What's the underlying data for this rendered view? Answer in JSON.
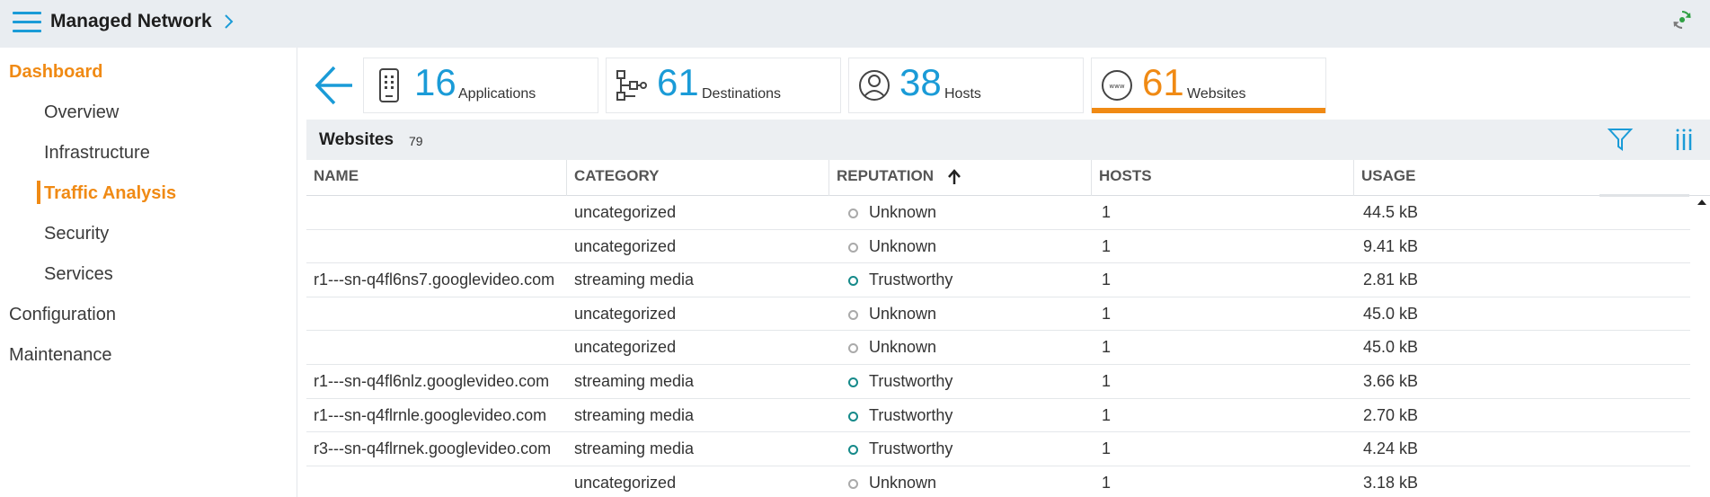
{
  "header": {
    "title": "Managed Network",
    "menu_icon": "hamburger-menu-icon",
    "chevron_icon": "chevron-right-icon",
    "refresh_icon": "refresh-icon"
  },
  "sidebar": {
    "items": [
      {
        "label": "Dashboard"
      },
      {
        "label": "Overview"
      },
      {
        "label": "Infrastructure"
      },
      {
        "label": "Traffic Analysis"
      },
      {
        "label": "Security"
      },
      {
        "label": "Services"
      },
      {
        "label": "Configuration"
      },
      {
        "label": "Maintenance"
      }
    ],
    "active_item": "Traffic Analysis"
  },
  "stats": [
    {
      "value": "16",
      "label": "Applications",
      "icon": "mobile-device-icon"
    },
    {
      "value": "61",
      "label": "Destinations",
      "icon": "network-tree-icon"
    },
    {
      "value": "38",
      "label": "Hosts",
      "icon": "user-circle-icon"
    },
    {
      "value": "61",
      "label": "Websites",
      "icon": "www-globe-icon",
      "selected": true
    }
  ],
  "panel": {
    "title": "Websites",
    "count": "79"
  },
  "table": {
    "columns": [
      "NAME",
      "CATEGORY",
      "REPUTATION",
      "HOSTS",
      "USAGE"
    ],
    "sorted_by": "REPUTATION",
    "sort_direction": "ascending",
    "rows": [
      {
        "name": "",
        "category": "uncategorized",
        "reputation": "Unknown",
        "hosts": "1",
        "usage": "44.5 kB"
      },
      {
        "name": "",
        "category": "uncategorized",
        "reputation": "Unknown",
        "hosts": "1",
        "usage": "9.41 kB"
      },
      {
        "name": "r1---sn-q4fl6ns7.googlevideo.com",
        "category": "streaming media",
        "reputation": "Trustworthy",
        "hosts": "1",
        "usage": "2.81 kB"
      },
      {
        "name": "",
        "category": "uncategorized",
        "reputation": "Unknown",
        "hosts": "1",
        "usage": "45.0 kB"
      },
      {
        "name": "",
        "category": "uncategorized",
        "reputation": "Unknown",
        "hosts": "1",
        "usage": "45.0 kB"
      },
      {
        "name": "r1---sn-q4fl6nlz.googlevideo.com",
        "category": "streaming media",
        "reputation": "Trustworthy",
        "hosts": "1",
        "usage": "3.66 kB"
      },
      {
        "name": "r1---sn-q4flrnle.googlevideo.com",
        "category": "streaming media",
        "reputation": "Trustworthy",
        "hosts": "1",
        "usage": "2.70 kB"
      },
      {
        "name": "r3---sn-q4flrnek.googlevideo.com",
        "category": "streaming media",
        "reputation": "Trustworthy",
        "hosts": "1",
        "usage": "4.24 kB"
      },
      {
        "name": "",
        "category": "uncategorized",
        "reputation": "Unknown",
        "hosts": "1",
        "usage": "3.18 kB"
      }
    ]
  },
  "colors": {
    "accent_blue": "#1a9bd7",
    "accent_orange": "#f08a14",
    "trust_teal": "#168a8a",
    "unknown_gray": "#aaaaaa"
  }
}
